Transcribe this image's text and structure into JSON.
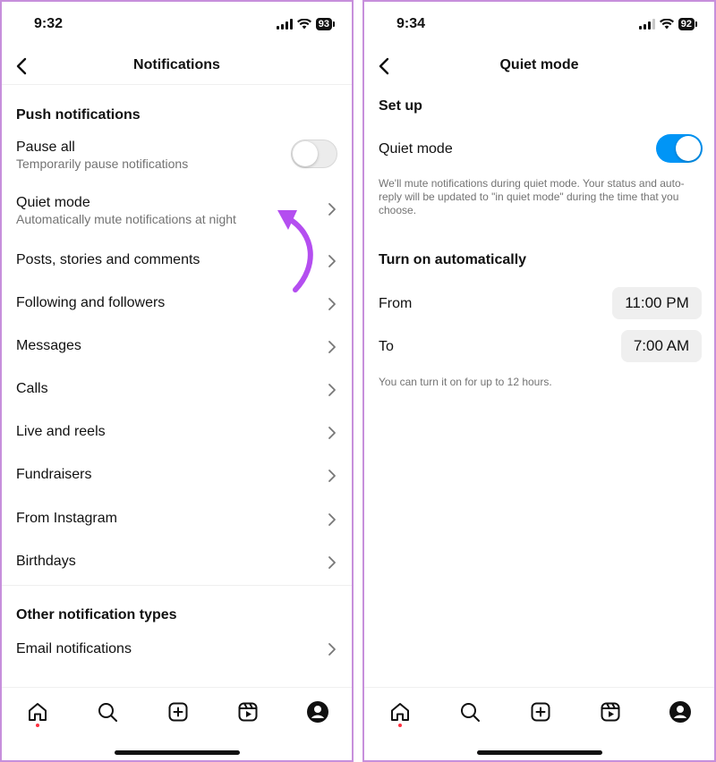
{
  "left_screen": {
    "status": {
      "time": "9:32",
      "battery": "93"
    },
    "nav": {
      "title": "Notifications"
    },
    "push_section": {
      "header": "Push notifications",
      "pause_all": {
        "title": "Pause all",
        "subtitle": "Temporarily pause notifications",
        "enabled": false
      },
      "quiet_mode": {
        "title": "Quiet mode",
        "subtitle": "Automatically mute notifications at night"
      },
      "items": [
        "Posts, stories and comments",
        "Following and followers",
        "Messages",
        "Calls",
        "Live and reels",
        "Fundraisers",
        "From Instagram",
        "Birthdays"
      ]
    },
    "other_section": {
      "header": "Other notification types",
      "items": [
        "Email notifications"
      ]
    },
    "annotation_color": "#b44ef0"
  },
  "right_screen": {
    "status": {
      "time": "9:34",
      "battery": "92"
    },
    "nav": {
      "title": "Quiet mode"
    },
    "setup_section": {
      "header": "Set up",
      "quiet_mode_label": "Quiet mode",
      "quiet_mode_enabled": true,
      "description": "We'll mute notifications during quiet mode. Your status and auto-reply will be updated to \"in quiet mode\" during the time that you choose."
    },
    "auto_section": {
      "header": "Turn on automatically",
      "from_label": "From",
      "from_value": "11:00 PM",
      "to_label": "To",
      "to_value": "7:00 AM",
      "note": "You can turn it on for up to 12 hours."
    }
  },
  "tab_bar": {
    "tabs": [
      "home-icon",
      "search-icon",
      "create-icon",
      "reels-icon",
      "profile-icon"
    ],
    "active": "home-icon"
  },
  "colors": {
    "accent_blue": "#0095f6",
    "notification_dot": "#ff3040",
    "border": "#c78fdc"
  }
}
